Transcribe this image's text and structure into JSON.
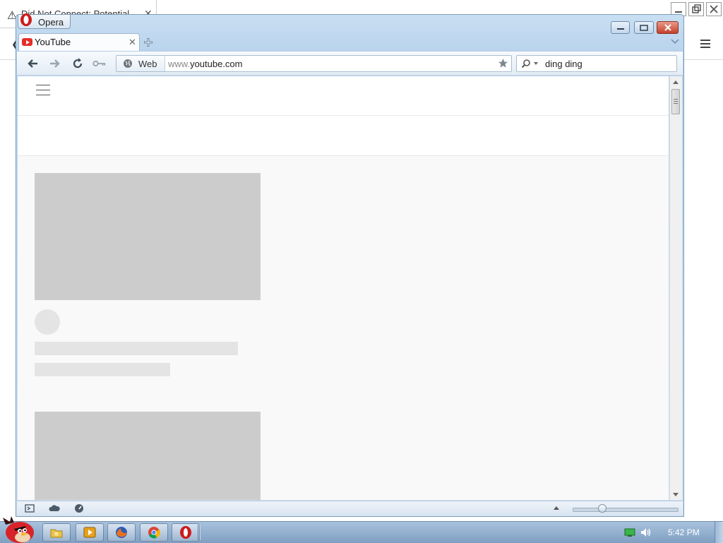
{
  "background_browser": {
    "tab_title": "Did Not Connect: Potential",
    "tab_close": "✕",
    "warning_icon": "warning-icon"
  },
  "opera": {
    "menu_label": "Opera",
    "tab": {
      "title": "YouTube",
      "close": "✕",
      "icon": "youtube-icon"
    },
    "address": {
      "badge": "Web",
      "url_prefix": "www.",
      "url_domain": "youtube.com"
    },
    "search": {
      "value": "ding ding"
    }
  },
  "taskbar": {
    "clock": "5:42 PM",
    "apps": [
      "folder-icon",
      "media-player-icon",
      "firefox-icon",
      "chrome-icon",
      "opera-icon"
    ]
  },
  "colors": {
    "window_frame": "#b7d2ec",
    "close_button": "#c4402a",
    "placeholder_dark": "#cccccc",
    "placeholder_light": "#e4e4e4",
    "youtube_red": "#e52d27"
  }
}
